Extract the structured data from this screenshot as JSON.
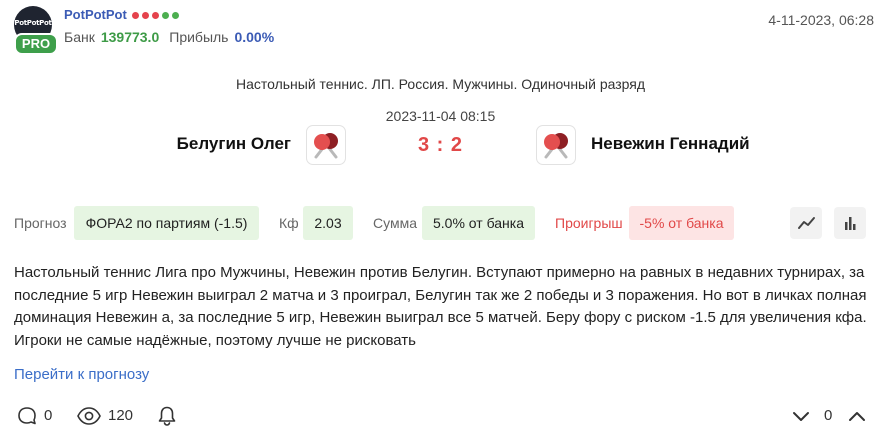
{
  "header": {
    "avatar_text": "PotPotPot",
    "badge": "PRO",
    "username": "PotPotPot",
    "rating_dots": [
      {
        "color": "#e5434c"
      },
      {
        "color": "#e5434c"
      },
      {
        "color": "#e5434c"
      },
      {
        "color": "#4caf50"
      },
      {
        "color": "#4caf50"
      }
    ],
    "bank_label": "Банк",
    "bank_value": "139773.0",
    "profit_label": "Прибыль",
    "profit_value": "0.00%",
    "date": "4-11-2023, 06:28"
  },
  "match": {
    "league": "Настольный теннис. ЛП. Россия. Мужчины. Одиночный разряд",
    "datetime": "2023-11-04 08:15",
    "team1": "Белугин Олег",
    "team2": "Невежин Геннадий",
    "score": "3 : 2"
  },
  "stats": {
    "forecast_label": "Прогноз",
    "forecast_value": "ФОРА2 по партиям (-1.5)",
    "kf_label": "Кф",
    "kf_value": "2.03",
    "sum_label": "Сумма",
    "sum_value": "5.0% от банка",
    "result_label": "Проигрыш",
    "result_value": "-5% от банка"
  },
  "description": "Настольный теннис Лига про Мужчины, Невежин против Белугин. Вступают примерно на равных в недавних турнирах, за последние 5 игр Невежин выиграл 2 матча и 3 проиграл, Белугин так же 2 победы и 3 поражения. Но вот в личках полная доминация Невежин а, за последние 5 игр, Невежин выиграл все 5 матчей. Беру фору с риском -1.5 для увеличения кфа. Игроки не самые надёжные, поэтому лучше не рисковать",
  "link_label": "Перейти к прогнозу",
  "footer": {
    "comments_count": "0",
    "views_count": "120",
    "votes_count": "0"
  },
  "colors": {
    "accent_blue": "#3b5bb5",
    "bank_green": "#3e9b47",
    "loss_red": "#e14848",
    "chip_green": "#e6f5e2",
    "chip_red": "#fde4e4"
  },
  "icons": [
    "ping-pong-icon",
    "line-chart-icon",
    "bar-chart-icon",
    "comment-icon",
    "eye-icon",
    "bell-icon",
    "chevron-down-icon",
    "chevron-up-icon"
  ]
}
